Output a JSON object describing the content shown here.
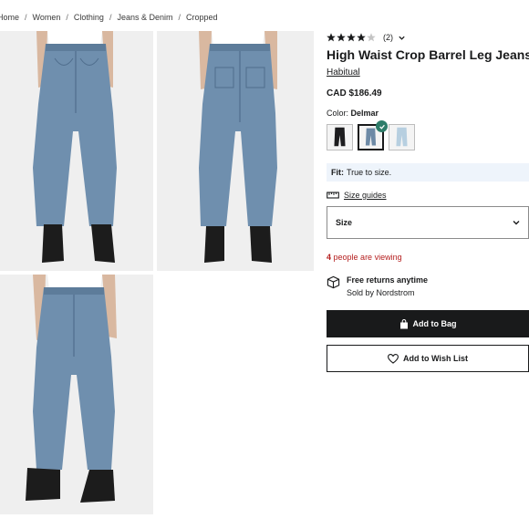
{
  "breadcrumb": [
    "Home",
    "Women",
    "Clothing",
    "Jeans & Denim",
    "Cropped"
  ],
  "breadcrumb_separator": "/",
  "product": {
    "rating": 4,
    "rating_max": 5,
    "review_count": "(2)",
    "title": "High Waist Crop Barrel Leg Jeans",
    "brand": "Habitual",
    "price": "CAD $186.49",
    "color_label": "Color:",
    "color_value": "Delmar",
    "swatches": [
      {
        "name": "black",
        "color": "#1d1d1f",
        "selected": false
      },
      {
        "name": "Delmar",
        "color": "#6d8aa6",
        "selected": true
      },
      {
        "name": "light",
        "color": "#b7cfe0",
        "selected": false
      }
    ],
    "fit_label": "Fit:",
    "fit_value": "True to size.",
    "size_guides": "Size guides",
    "size_select_label": "Size",
    "viewing_count": "4",
    "viewing_text": "people are viewing",
    "returns_title": "Free returns anytime",
    "returns_sub": "Sold by Nordstrom",
    "add_to_bag": "Add to Bag",
    "add_to_wishlist": "Add to Wish List"
  },
  "colors": {
    "denim": "#6f8fae",
    "denim_dark": "#4f6d8c",
    "accent_check": "#2e7d6a",
    "viewing_red": "#b51f1f",
    "fit_bg": "#eef4fb",
    "button_dark": "#191a1b"
  },
  "icons": {
    "star": "star-icon",
    "chevron": "chevron-down-icon",
    "ruler": "ruler-icon",
    "box": "box-icon",
    "bag": "bag-icon",
    "heart": "heart-icon",
    "check": "check-icon"
  }
}
